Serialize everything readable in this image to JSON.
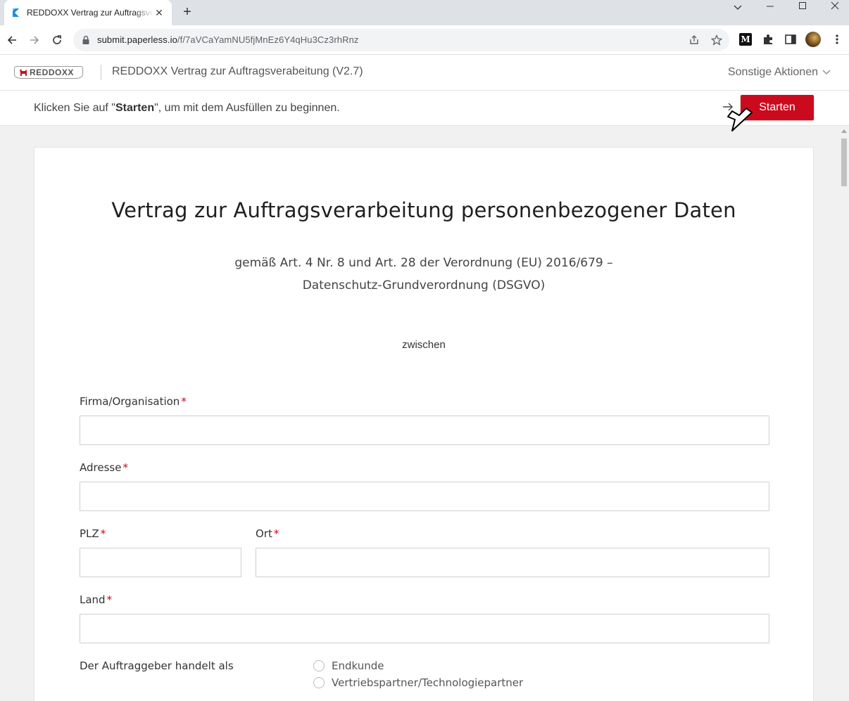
{
  "browser": {
    "tab_title": "REDDOXX Vertrag zur Auftragsverarbeitung (V2.7)",
    "url_host": "submit.paperless.io",
    "url_path": "/f/7aVCaYamNU5fjMnEz6Y4qHu3Cz3rhRnz"
  },
  "header": {
    "logo_text": "REDDOXX",
    "form_title": "REDDOXX Vertrag zur Auftragsverabeitung (V2.7)",
    "actions_label": "Sonstige Aktionen"
  },
  "startbar": {
    "msg_pre": "Klicken Sie auf \"",
    "msg_bold": "Starten",
    "msg_post": "\", um mit dem Ausfüllen zu beginnen.",
    "start_label": "Starten"
  },
  "document": {
    "title": "Vertrag zur Auftragsverarbeitung personenbezogener Daten",
    "subtitle_line1": "gemäß Art. 4 Nr. 8 und Art. 28 der Verordnung (EU) 2016/679 –",
    "subtitle_line2": "Datenschutz-Grundverordnung (DSGVO)",
    "between": "zwischen",
    "fields": {
      "firma": {
        "label": "Firma/Organisation",
        "value": ""
      },
      "adresse": {
        "label": "Adresse",
        "value": ""
      },
      "plz": {
        "label": "PLZ",
        "value": ""
      },
      "ort": {
        "label": "Ort",
        "value": ""
      },
      "land": {
        "label": "Land",
        "value": ""
      }
    },
    "required_mark": "*",
    "role_question": "Der Auftraggeber handelt als",
    "role_options": [
      "Endkunde",
      "Vertriebspartner/Technologiepartner"
    ]
  }
}
